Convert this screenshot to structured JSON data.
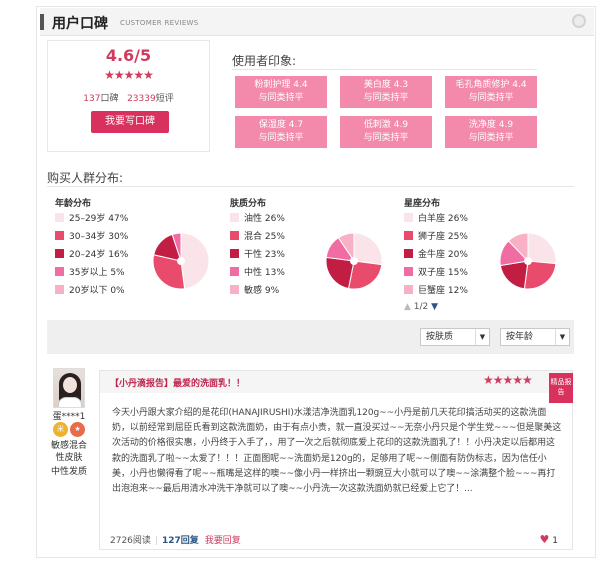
{
  "header": {
    "title": "用户口碑",
    "subtitle": "CUSTOMER REVIEWS"
  },
  "score": {
    "value": "4.6/5",
    "stars": "★★★★★",
    "reviews_count": "137",
    "reviews_label": "口碑",
    "short_count": "23339",
    "short_label": "短评",
    "write_button": "我要写口碑"
  },
  "impressions": {
    "title": "使用者印象:",
    "tags": [
      {
        "line1": "粉刺护理 4.4",
        "line2": "与同类持平"
      },
      {
        "line1": "美白度 4.3",
        "line2": "与同类持平"
      },
      {
        "line1": "毛孔角质修护 4.4",
        "line2": "与同类持平"
      },
      {
        "line1": "保湿度 4.7",
        "line2": "与同类持平"
      },
      {
        "line1": "低刺激 4.9",
        "line2": "与同类持平"
      },
      {
        "line1": "洗净度 4.9",
        "line2": "与同类持平"
      }
    ]
  },
  "distribution": {
    "title": "购买人群分布:",
    "age": {
      "title": "年龄分布",
      "items": [
        {
          "label": "25–29岁",
          "pct": "47%",
          "value": 47,
          "color": "#fbe3ea"
        },
        {
          "label": "30–34岁",
          "pct": "30%",
          "value": 30,
          "color": "#e84b6c"
        },
        {
          "label": "20–24岁",
          "pct": "16%",
          "value": 16,
          "color": "#c21d43"
        },
        {
          "label": "35岁以上",
          "pct": "5%",
          "value": 5,
          "color": "#f06da4"
        },
        {
          "label": "20岁以下",
          "pct": "0%",
          "value": 0,
          "color": "#f7b0c4"
        }
      ]
    },
    "skin": {
      "title": "肤质分布",
      "items": [
        {
          "label": "油性",
          "pct": "26%",
          "value": 26,
          "color": "#fbe3ea"
        },
        {
          "label": "混合",
          "pct": "25%",
          "value": 25,
          "color": "#e84b6c"
        },
        {
          "label": "干性",
          "pct": "23%",
          "value": 23,
          "color": "#c21d43"
        },
        {
          "label": "中性",
          "pct": "13%",
          "value": 13,
          "color": "#f06da4"
        },
        {
          "label": "敏感",
          "pct": "9%",
          "value": 9,
          "color": "#f7b0c4"
        }
      ]
    },
    "zodiac": {
      "title": "星座分布",
      "items": [
        {
          "label": "白羊座",
          "pct": "26%",
          "value": 26,
          "color": "#fbe3ea"
        },
        {
          "label": "狮子座",
          "pct": "25%",
          "value": 25,
          "color": "#e84b6c"
        },
        {
          "label": "金牛座",
          "pct": "20%",
          "value": 20,
          "color": "#c21d43"
        },
        {
          "label": "双子座",
          "pct": "15%",
          "value": 15,
          "color": "#f06da4"
        },
        {
          "label": "巨蟹座",
          "pct": "12%",
          "value": 12,
          "color": "#f7b0c4"
        }
      ],
      "pager": "1/2"
    }
  },
  "filters": {
    "skin_select": "按肤质",
    "age_select": "按年龄"
  },
  "review": {
    "user": "蛋****1",
    "badge1": "米",
    "badge2": "★",
    "trait_skin": "敏感混合性皮肤",
    "trait_type": "中性发质",
    "title": "【小丹滴报告】最爱的洗面乳！！",
    "stars": "★★★★★",
    "ribbon": "精品报告",
    "body": "今天小丹跟大家介绍的是花印(HANAJIRUSHI)水漾洁净洗面乳120g~~小丹是前几天花印搞活动买的这款洗面奶，以前经常到屈臣氏看到这款洗面奶，由于有点小贵，就一直没买过~~无奈小丹只是个学生党~~~但是聚美这次活动的价格很实惠，小丹终于入手了，，用了一次之后就彻底爱上花印的这款洗面乳了！！小丹决定以后都用这款的洗面乳了啦~~太爱了！！！正面图呢~~洗面奶是120g的，足够用了呢~~侧面有防伪标志，因为信任小美，小丹也懒得看了呢~~瓶嘴是这样的噢~~像小丹一样挤出一颗豌豆大小就可以了噢~~涂满整个脸~~~再打出泡泡来~~最后用清水冲洗干净就可以了噢~~小丹洗一次这款洗面奶就已经爱上它了！...",
    "views": "2726阅读",
    "replies": "127回复",
    "my_reply": "我要回复",
    "likes": "1"
  }
}
